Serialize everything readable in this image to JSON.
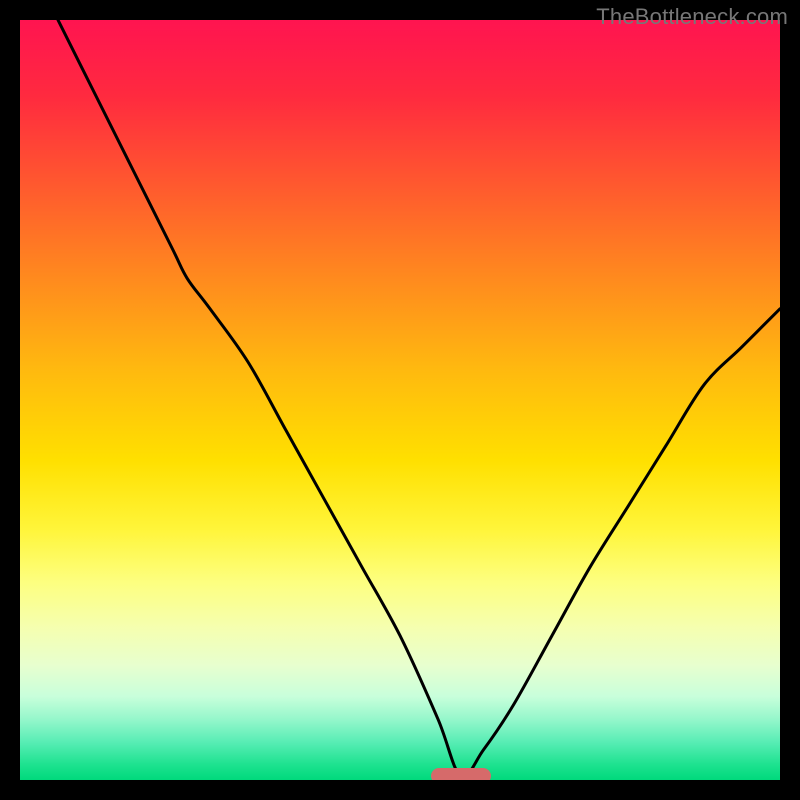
{
  "watermark": "TheBottleneck.com",
  "colors": {
    "pill": "#d66a6a",
    "curve_stroke": "#000000",
    "frame_bg": "#000000"
  },
  "chart_data": {
    "type": "line",
    "title": "",
    "xlabel": "",
    "ylabel": "",
    "xlim": [
      0,
      100
    ],
    "ylim": [
      0,
      100
    ],
    "grid": false,
    "target_marker": {
      "x_percent": 58,
      "y_percent": 99.5
    },
    "series": [
      {
        "name": "bottleneck-curve",
        "x": [
          5,
          10,
          15,
          20,
          22,
          25,
          30,
          35,
          40,
          45,
          50,
          55,
          58,
          61,
          65,
          70,
          75,
          80,
          85,
          90,
          95,
          100
        ],
        "y": [
          100,
          90,
          80,
          70,
          66,
          62,
          55,
          46,
          37,
          28,
          19,
          8,
          0.5,
          4,
          10,
          19,
          28,
          36,
          44,
          52,
          57,
          62
        ]
      }
    ],
    "gradient_stops": [
      {
        "pos": 0,
        "color": "#ff1450"
      },
      {
        "pos": 10,
        "color": "#ff2a3f"
      },
      {
        "pos": 22,
        "color": "#ff5a2e"
      },
      {
        "pos": 34,
        "color": "#ff8a1e"
      },
      {
        "pos": 46,
        "color": "#ffb90f"
      },
      {
        "pos": 58,
        "color": "#ffe000"
      },
      {
        "pos": 67,
        "color": "#fff53a"
      },
      {
        "pos": 74,
        "color": "#fdff80"
      },
      {
        "pos": 80,
        "color": "#f5ffb0"
      },
      {
        "pos": 85,
        "color": "#e7ffcf"
      },
      {
        "pos": 89,
        "color": "#c8ffdb"
      },
      {
        "pos": 92,
        "color": "#95f7cb"
      },
      {
        "pos": 95,
        "color": "#58edb5"
      },
      {
        "pos": 98,
        "color": "#1de28f"
      },
      {
        "pos": 100,
        "color": "#00d97c"
      }
    ]
  }
}
